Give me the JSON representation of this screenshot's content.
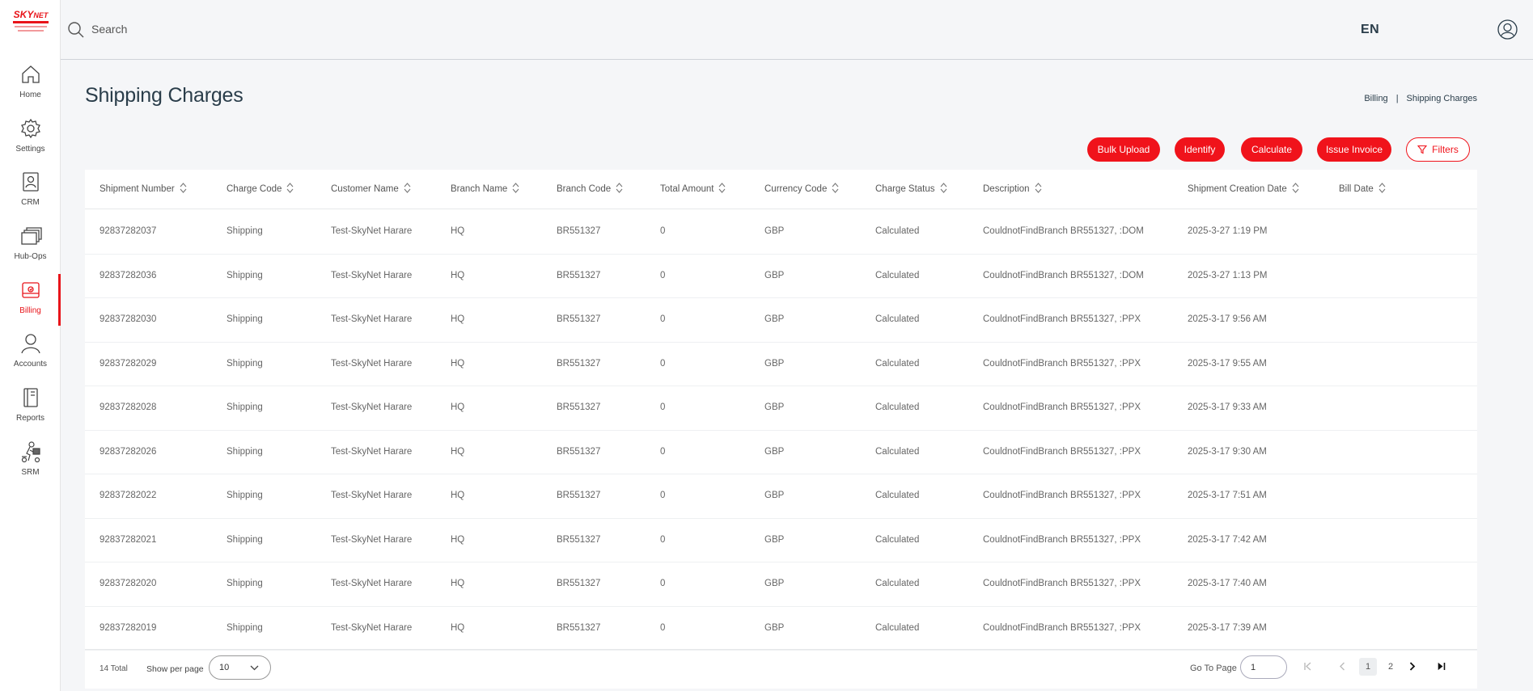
{
  "app": {
    "logo_text": "SKYNET",
    "logo_tagline": "Worldwide Express",
    "language": "EN"
  },
  "search": {
    "placeholder": "Search"
  },
  "sidebar": {
    "items": [
      {
        "label": "Home",
        "icon": "home-icon"
      },
      {
        "label": "Settings",
        "icon": "gear-icon"
      },
      {
        "label": "CRM",
        "icon": "contact-card-icon"
      },
      {
        "label": "Hub-Ops",
        "icon": "stack-icon"
      },
      {
        "label": "Billing",
        "icon": "billing-icon",
        "active": true
      },
      {
        "label": "Accounts",
        "icon": "user-icon"
      },
      {
        "label": "Reports",
        "icon": "report-icon"
      },
      {
        "label": "SRM",
        "icon": "courier-icon"
      }
    ]
  },
  "page": {
    "title": "Shipping Charges",
    "breadcrumb": [
      "Billing",
      "Shipping Charges"
    ],
    "breadcrumb_sep": "|"
  },
  "actions": {
    "bulk_upload": "Bulk Upload",
    "identify": "Identify",
    "calculate": "Calculate",
    "issue_invoice": "Issue Invoice",
    "filters": "Filters"
  },
  "table": {
    "columns": [
      "Shipment Number",
      "Charge Code",
      "Customer Name",
      "Branch Name",
      "Branch Code",
      "Total Amount",
      "Currency Code",
      "Charge Status",
      "Description",
      "Shipment Creation Date",
      "Bill Date"
    ],
    "rows": [
      [
        "92837282037",
        "Shipping",
        "Test-SkyNet Harare",
        "HQ",
        "BR551327",
        "0",
        "GBP",
        "Calculated",
        "CouldnotFindBranch BR551327, :DOM",
        "2025-3-27 1:19 PM",
        ""
      ],
      [
        "92837282036",
        "Shipping",
        "Test-SkyNet Harare",
        "HQ",
        "BR551327",
        "0",
        "GBP",
        "Calculated",
        "CouldnotFindBranch BR551327, :DOM",
        "2025-3-27 1:13 PM",
        ""
      ],
      [
        "92837282030",
        "Shipping",
        "Test-SkyNet Harare",
        "HQ",
        "BR551327",
        "0",
        "GBP",
        "Calculated",
        "CouldnotFindBranch BR551327, :PPX",
        "2025-3-17 9:56 AM",
        ""
      ],
      [
        "92837282029",
        "Shipping",
        "Test-SkyNet Harare",
        "HQ",
        "BR551327",
        "0",
        "GBP",
        "Calculated",
        "CouldnotFindBranch BR551327, :PPX",
        "2025-3-17 9:55 AM",
        ""
      ],
      [
        "92837282028",
        "Shipping",
        "Test-SkyNet Harare",
        "HQ",
        "BR551327",
        "0",
        "GBP",
        "Calculated",
        "CouldnotFindBranch BR551327, :PPX",
        "2025-3-17 9:33 AM",
        ""
      ],
      [
        "92837282026",
        "Shipping",
        "Test-SkyNet Harare",
        "HQ",
        "BR551327",
        "0",
        "GBP",
        "Calculated",
        "CouldnotFindBranch BR551327, :PPX",
        "2025-3-17 9:30 AM",
        ""
      ],
      [
        "92837282022",
        "Shipping",
        "Test-SkyNet Harare",
        "HQ",
        "BR551327",
        "0",
        "GBP",
        "Calculated",
        "CouldnotFindBranch BR551327, :PPX",
        "2025-3-17 7:51 AM",
        ""
      ],
      [
        "92837282021",
        "Shipping",
        "Test-SkyNet Harare",
        "HQ",
        "BR551327",
        "0",
        "GBP",
        "Calculated",
        "CouldnotFindBranch BR551327, :PPX",
        "2025-3-17 7:42 AM",
        ""
      ],
      [
        "92837282020",
        "Shipping",
        "Test-SkyNet Harare",
        "HQ",
        "BR551327",
        "0",
        "GBP",
        "Calculated",
        "CouldnotFindBranch BR551327, :PPX",
        "2025-3-17 7:40 AM",
        ""
      ],
      [
        "92837282019",
        "Shipping",
        "Test-SkyNet Harare",
        "HQ",
        "BR551327",
        "0",
        "GBP",
        "Calculated",
        "CouldnotFindBranch BR551327, :PPX",
        "2025-3-17 7:39 AM",
        ""
      ]
    ]
  },
  "pagination": {
    "total_text": "14 Total",
    "per_page_label": "Show per page",
    "per_page_value": "10",
    "goto_label": "Go To Page",
    "goto_value": "1",
    "pages": [
      "1",
      "2"
    ],
    "current_page": "1"
  },
  "colors": {
    "accent": "#f0131b",
    "title": "#2a3d4a"
  }
}
